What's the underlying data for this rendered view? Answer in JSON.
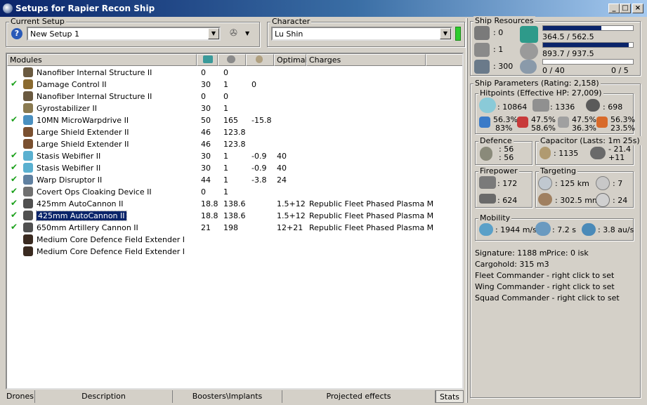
{
  "window": {
    "title": "Setups for Rapier Recon Ship"
  },
  "current_setup": {
    "label": "Current Setup",
    "value": "New Setup 1"
  },
  "character": {
    "label": "Character",
    "value": "Lu Shin"
  },
  "modules_table": {
    "headers": [
      "Modules",
      "",
      "",
      "",
      "Optimal",
      "Charges"
    ],
    "rows": [
      {
        "check": false,
        "name": "Nanofiber Internal Structure II",
        "cpu": "0",
        "pg": "0",
        "cap": "",
        "optimal": "",
        "charges": "",
        "icon_color": "#6a5a40"
      },
      {
        "check": true,
        "name": "Damage Control II",
        "cpu": "30",
        "pg": "1",
        "cap": "0",
        "optimal": "",
        "charges": "",
        "icon_color": "#8a6a30"
      },
      {
        "check": false,
        "name": "Nanofiber Internal Structure II",
        "cpu": "0",
        "pg": "0",
        "cap": "",
        "optimal": "",
        "charges": "",
        "icon_color": "#6a5a40"
      },
      {
        "check": false,
        "name": "Gyrostabilizer II",
        "cpu": "30",
        "pg": "1",
        "cap": "",
        "optimal": "",
        "charges": "",
        "icon_color": "#8a7a50"
      },
      {
        "check": true,
        "name": "10MN MicroWarpdrive II",
        "cpu": "50",
        "pg": "165",
        "cap": "-15.8",
        "optimal": "",
        "charges": "",
        "icon_color": "#4a90c0"
      },
      {
        "check": false,
        "name": "Large Shield Extender II",
        "cpu": "46",
        "pg": "123.8",
        "cap": "",
        "optimal": "",
        "charges": "",
        "icon_color": "#7a5030"
      },
      {
        "check": false,
        "name": "Large Shield Extender II",
        "cpu": "46",
        "pg": "123.8",
        "cap": "",
        "optimal": "",
        "charges": "",
        "icon_color": "#7a5030"
      },
      {
        "check": true,
        "name": "Stasis Webifier II",
        "cpu": "30",
        "pg": "1",
        "cap": "-0.9",
        "optimal": "40",
        "charges": "",
        "icon_color": "#5ab0d0"
      },
      {
        "check": true,
        "name": "Stasis Webifier II",
        "cpu": "30",
        "pg": "1",
        "cap": "-0.9",
        "optimal": "40",
        "charges": "",
        "icon_color": "#5ab0d0"
      },
      {
        "check": true,
        "name": "Warp Disruptor II",
        "cpu": "44",
        "pg": "1",
        "cap": "-3.8",
        "optimal": "24",
        "charges": "",
        "icon_color": "#6080a0"
      },
      {
        "check": true,
        "name": "Covert Ops Cloaking Device II",
        "cpu": "0",
        "pg": "1",
        "cap": "",
        "optimal": "",
        "charges": "",
        "icon_color": "#707070"
      },
      {
        "check": true,
        "name": "425mm AutoCannon II",
        "cpu": "18.8",
        "pg": "138.6",
        "cap": "",
        "optimal": "1.5+12",
        "charges": "Republic Fleet Phased Plasma M",
        "icon_color": "#505050"
      },
      {
        "check": true,
        "name": "425mm AutoCannon II",
        "cpu": "18.8",
        "pg": "138.6",
        "cap": "",
        "optimal": "1.5+12",
        "charges": "Republic Fleet Phased Plasma M",
        "icon_color": "#505050",
        "selected": true
      },
      {
        "check": true,
        "name": "650mm Artillery Cannon II",
        "cpu": "21",
        "pg": "198",
        "cap": "",
        "optimal": "12+21",
        "charges": "Republic Fleet Phased Plasma M",
        "icon_color": "#505050"
      },
      {
        "check": false,
        "name": "Medium Core Defence Field Extender I",
        "cpu": "",
        "pg": "",
        "cap": "",
        "optimal": "",
        "charges": "",
        "icon_color": "#3a2a20"
      },
      {
        "check": false,
        "name": "Medium Core Defence Field Extender I",
        "cpu": "",
        "pg": "",
        "cap": "",
        "optimal": "",
        "charges": "",
        "icon_color": "#3a2a20"
      }
    ]
  },
  "bottom_tabs": [
    "Drones",
    "Description",
    "Boosters\\Implants",
    "Projected effects",
    "Stats"
  ],
  "ship_resources": {
    "label": "Ship Resources",
    "turret_slots": ": 0",
    "launcher_slots": ": 1",
    "calibration": ": 300",
    "cpu": "364.5 / 562.5",
    "cpu_fraction": 0.648,
    "powergrid": "893.7 / 937.5",
    "powergrid_fraction": 0.953,
    "drone_bandwidth": "0 / 40",
    "drones": "0 / 5"
  },
  "ship_parameters": {
    "label": "Ship Parameters (Rating: 2,158)",
    "hitpoints": {
      "label": "Hitpoints (Effective HP: 27,009)",
      "shield": ": 10864",
      "armor": ": 1336",
      "structure": ": 698",
      "em": "56.3%",
      "em2": "83%",
      "thermal": "47.5%",
      "thermal2": "58.6%",
      "kinetic": "47.5%",
      "kinetic2": "36.3%",
      "explosive": "56.3%",
      "explosive2": "23.5%"
    },
    "defence": {
      "label": "Defence",
      "v1": ": 56",
      "v2": ": 56"
    },
    "capacitor": {
      "label": "Capacitor (Lasts: 1m 25s)",
      "amount": ": 1135",
      "delta1": "- 21.4",
      "delta2": "+11"
    },
    "firepower": {
      "label": "Firepower",
      "volley": ": 172",
      "dps": ": 624"
    },
    "targeting": {
      "label": "Targeting",
      "range": ": 125 km",
      "max_targets": ": 7",
      "scan_res": ": 302.5 mm",
      "sensor": ": 24"
    },
    "mobility": {
      "label": "Mobility",
      "speed": ": 1944 m/s",
      "align": ": 7.2 s",
      "warp": ": 3.8 au/s"
    },
    "signature": "Signature: 1188 m",
    "price": "Price: 0 isk",
    "cargohold": "Cargohold: 315 m3",
    "fleet_commander": "Fleet Commander - right click to set",
    "wing_commander": "Wing Commander - right click to set",
    "squad_commander": "Squad Commander - right click to set"
  }
}
